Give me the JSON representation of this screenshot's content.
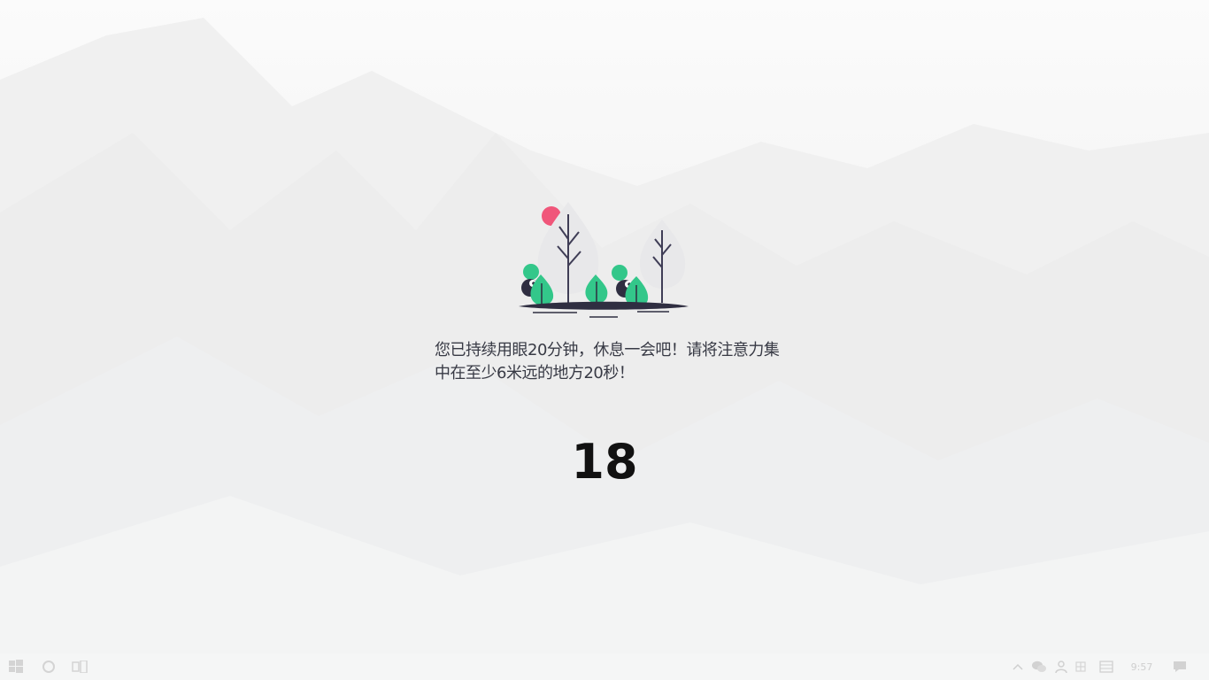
{
  "break_reminder": {
    "message": "您已持续用眼20分钟，休息一会吧！请将注意力集中在至少6米远的地方20秒！",
    "countdown": "18"
  },
  "taskbar": {
    "start_icon": "windows-logo-icon",
    "search_icon": "cortana-circle-icon",
    "task_view_icon": "task-view-icon",
    "tray_icons": [
      "chevron-up-icon",
      "wechat-icon",
      "people-icon",
      "network-icon",
      "keyboard-icon"
    ],
    "clock": "9:57",
    "notification_icon": "action-center-icon"
  },
  "colors": {
    "accent_green": "#33c78a",
    "accent_pink": "#f0567a",
    "text": "#383a45",
    "ground": "#2f2e41"
  }
}
